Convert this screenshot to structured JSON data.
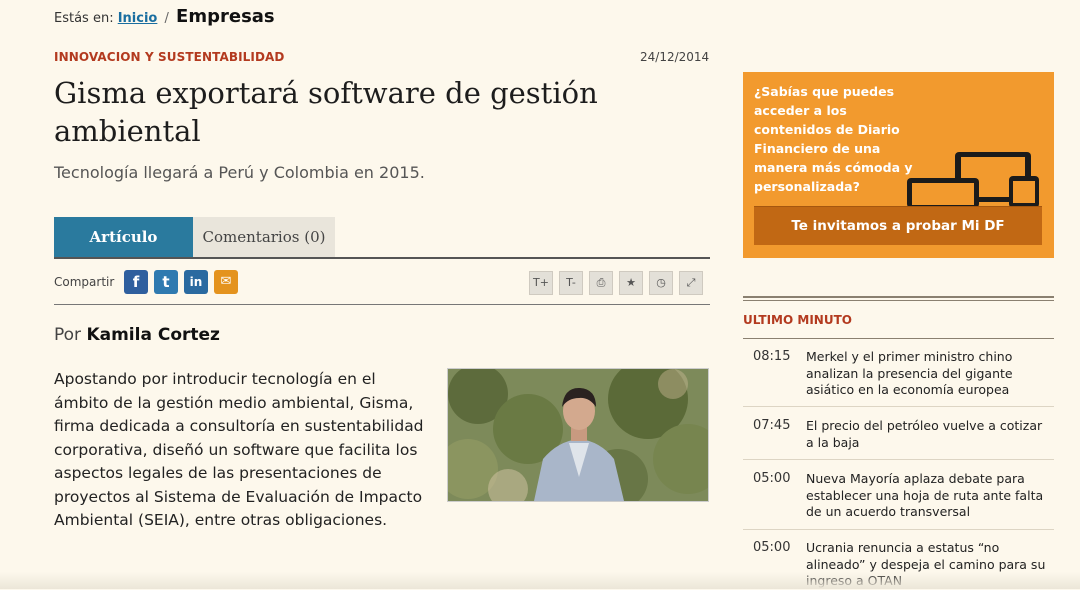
{
  "breadcrumb": {
    "label": "Estás en:",
    "home": "Inicio",
    "separator": "/",
    "current": "Empresas"
  },
  "article": {
    "kicker": "INNOVACION Y SUSTENTABILIDAD",
    "date": "24/12/2014",
    "title": "Gisma exportará software de gestión ambiental",
    "subtitle": "Tecnología llegará a Perú y Colombia en 2015.",
    "tabs": [
      {
        "label": "Artículo"
      },
      {
        "label": "Comentarios (0)"
      }
    ],
    "share_label": "Compartir",
    "social": {
      "facebook": "f",
      "twitter": "t",
      "linkedin": "in",
      "email": "✉"
    },
    "tools": {
      "text_bigger": "T+",
      "text_smaller": "T-",
      "print": "⎙",
      "favorite": "★",
      "history": "◷",
      "fullscreen": "⤢"
    },
    "byline_prefix": "Por",
    "author": "Kamila Cortez",
    "body": "Apostando por introducir tecnología en el ámbito de la gestión medio ambiental, Gisma, firma dedicada a consultoría en sustentabilidad corporativa, diseñó un software que facilita los aspectos legales de las presentaciones de proyectos al Sistema de Evaluación de Impacto Ambiental (SEIA), entre otras obligaciones."
  },
  "promo": {
    "text": "¿Sabías que puedes acceder a los contenidos de Diario Financiero de una manera más cómoda y personalizada?",
    "button": "Te invitamos a probar Mi DF",
    "bg_color": "#f29a2e"
  },
  "ultimo_minuto": {
    "heading": "ULTIMO MINUTO",
    "items": [
      {
        "time": "08:15",
        "text": "Merkel y el primer ministro chino analizan la presencia del gigante asiático en la economía europea"
      },
      {
        "time": "07:45",
        "text": "El precio del petróleo vuelve a cotizar a la baja"
      },
      {
        "time": "05:00",
        "text": "Nueva Mayoría aplaza debate para establecer una hoja de ruta ante falta de un acuerdo transversal"
      },
      {
        "time": "05:00",
        "text": "Ucrania renuncia a estatus “no alineado” y despeja el camino para su ingreso a OTAN"
      }
    ]
  }
}
